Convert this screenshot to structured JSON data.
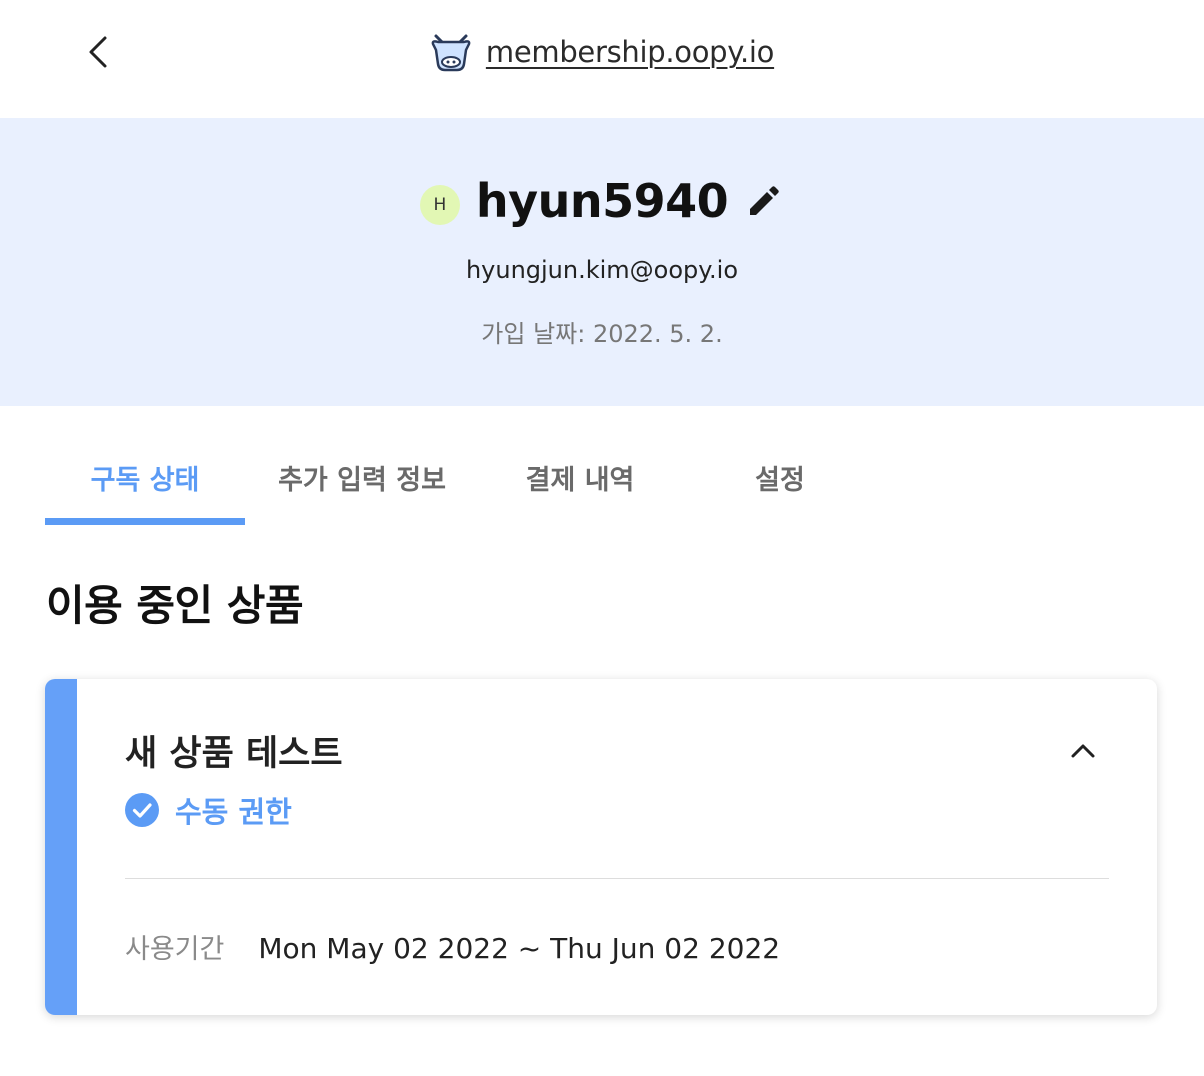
{
  "header": {
    "site_link": "membership.oopy.io",
    "back_icon": "chevron-left-icon",
    "logo_icon": "cow-logo-icon"
  },
  "profile": {
    "avatar_initial": "H",
    "username": "hyun5940",
    "email": "hyungjun.kim@oopy.io",
    "join_date": "가입 날짜: 2022. 5. 2.",
    "edit_icon": "pencil-icon"
  },
  "tabs": [
    {
      "label": "구독 상태",
      "active": true
    },
    {
      "label": "추가 입력 정보",
      "active": false
    },
    {
      "label": "결제 내역",
      "active": false
    },
    {
      "label": "설정",
      "active": false
    }
  ],
  "section": {
    "title": "이용 중인 상품"
  },
  "product": {
    "name": "새 상품 테스트",
    "permission_label": "수동 권한",
    "period_label": "사용기간",
    "period_value": "Mon May 02 2022 ~ Thu Jun 02 2022",
    "collapse_icon": "chevron-up-icon",
    "check_icon": "check-circle-icon"
  },
  "colors": {
    "accent": "#5b9bf5",
    "profile_bg": "#e9f0fe",
    "avatar_bg": "#e2f7b4"
  }
}
